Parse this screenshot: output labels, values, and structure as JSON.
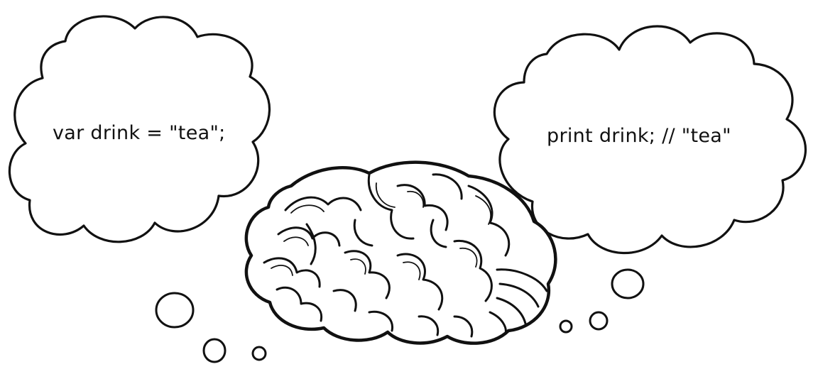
{
  "thought_left": {
    "text": "var drink = \"tea\";"
  },
  "thought_right": {
    "text": "print drink; // \"tea\""
  },
  "colors": {
    "ink": "#111111",
    "paper": "#ffffff"
  }
}
